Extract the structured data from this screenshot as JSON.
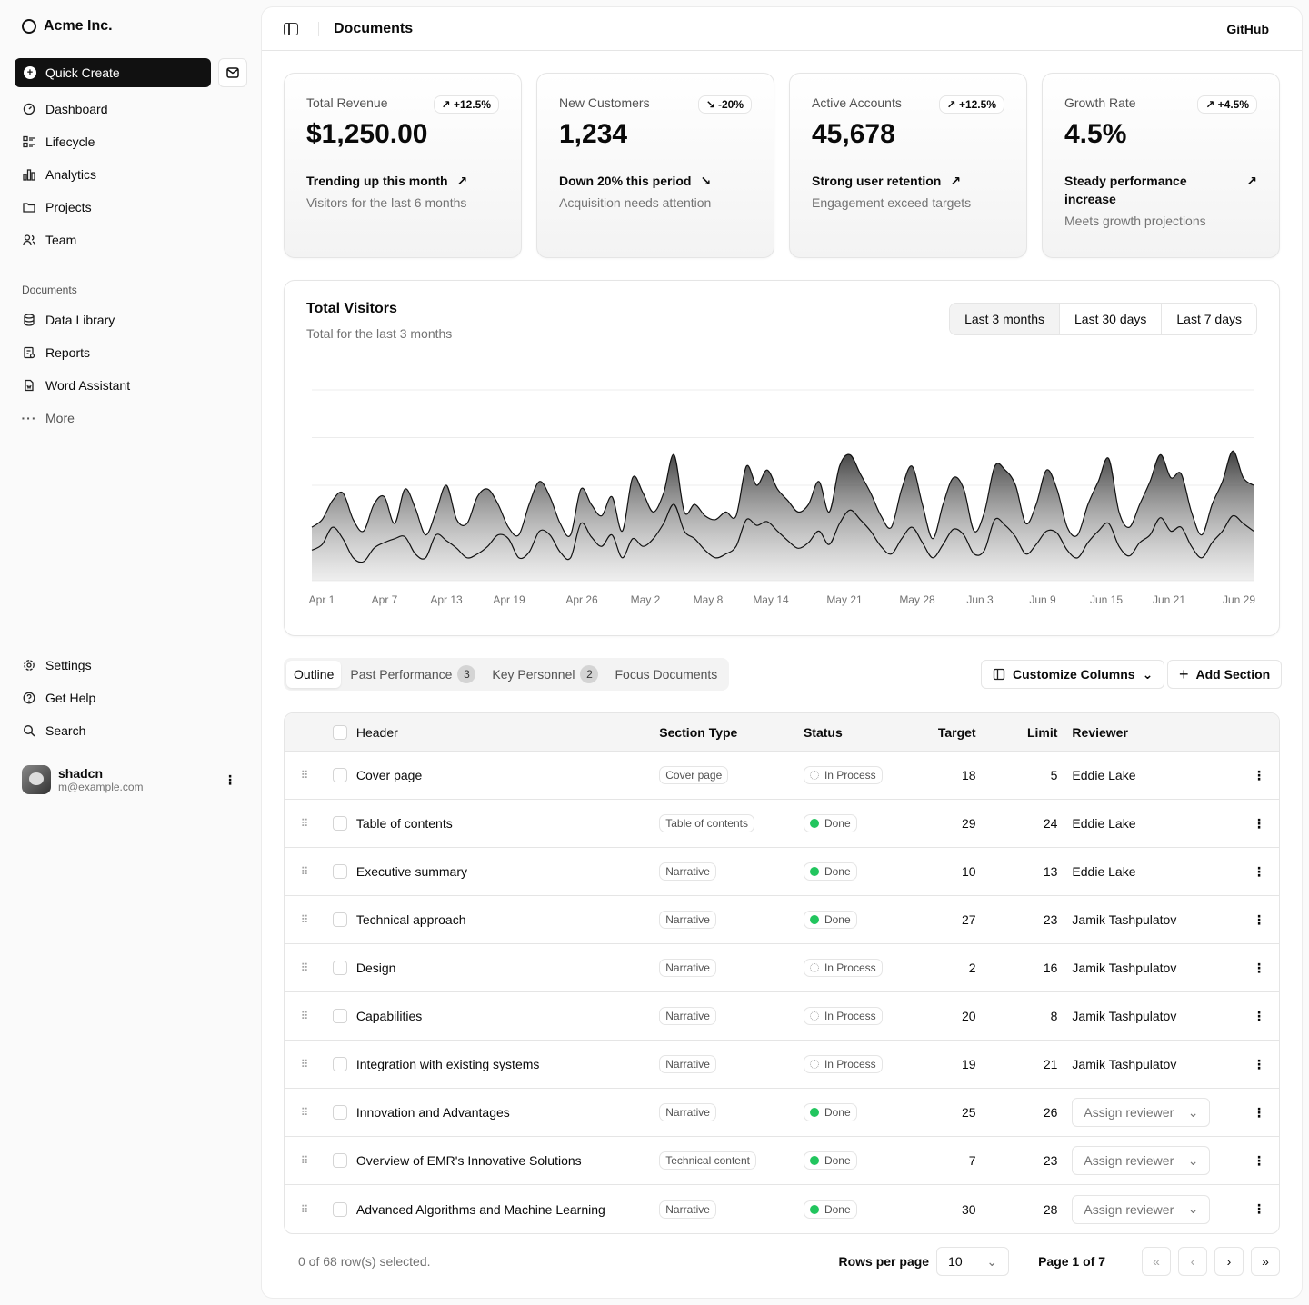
{
  "app": {
    "brand": "Acme Inc.",
    "page_title": "Documents",
    "github_label": "GitHub"
  },
  "sidebar": {
    "quick_create": "Quick Create",
    "main_items": [
      {
        "label": "Dashboard",
        "icon": "dashboard-icon"
      },
      {
        "label": "Lifecycle",
        "icon": "list-details-icon"
      },
      {
        "label": "Analytics",
        "icon": "chart-bar-icon"
      },
      {
        "label": "Projects",
        "icon": "folder-icon"
      },
      {
        "label": "Team",
        "icon": "users-icon"
      }
    ],
    "documents_label": "Documents",
    "doc_items": [
      {
        "label": "Data Library",
        "icon": "database-icon"
      },
      {
        "label": "Reports",
        "icon": "report-icon"
      },
      {
        "label": "Word Assistant",
        "icon": "file-word-icon"
      },
      {
        "label": "More",
        "icon": "dots-icon"
      }
    ],
    "bottom_items": [
      {
        "label": "Settings",
        "icon": "settings-icon"
      },
      {
        "label": "Get Help",
        "icon": "help-icon"
      },
      {
        "label": "Search",
        "icon": "search-icon"
      }
    ],
    "user": {
      "name": "shadcn",
      "email": "m@example.com"
    }
  },
  "cards": [
    {
      "label": "Total Revenue",
      "badge": "+12.5%",
      "direction": "up",
      "value": "$1,250.00",
      "trend": "Trending up this month",
      "sub": "Visitors for the last 6 months"
    },
    {
      "label": "New Customers",
      "badge": "-20%",
      "direction": "down",
      "value": "1,234",
      "trend": "Down 20% this period",
      "sub": "Acquisition needs attention"
    },
    {
      "label": "Active Accounts",
      "badge": "+12.5%",
      "direction": "up",
      "value": "45,678",
      "trend": "Strong user retention",
      "sub": "Engagement exceed targets"
    },
    {
      "label": "Growth Rate",
      "badge": "+4.5%",
      "direction": "up",
      "value": "4.5%",
      "trend": "Steady performance increase",
      "sub": "Meets growth projections"
    }
  ],
  "chart_card": {
    "title": "Total Visitors",
    "subtitle": "Total for the last 3 months",
    "ranges": [
      "Last 3 months",
      "Last 30 days",
      "Last 7 days"
    ],
    "selected_range": "Last 3 months"
  },
  "chart_data": {
    "type": "area",
    "title": "Total Visitors",
    "x_tick_labels": [
      "Apr 1",
      "Apr 7",
      "Apr 13",
      "Apr 19",
      "Apr 26",
      "May 2",
      "May 8",
      "May 14",
      "May 21",
      "May 28",
      "Jun 3",
      "Jun 9",
      "Jun 15",
      "Jun 21",
      "Jun 29"
    ],
    "y_range": [
      0,
      500
    ],
    "grid": "horizontal",
    "stacked": true,
    "series": [
      {
        "values": [
          80,
          95,
          140,
          110,
          60,
          50,
          85,
          100,
          110,
          115,
          70,
          60,
          120,
          105,
          85,
          60,
          70,
          90,
          120,
          110,
          60,
          75,
          130,
          120,
          75,
          60,
          150,
          115,
          90,
          120,
          60,
          110,
          90,
          110,
          150,
          200,
          130,
          110,
          80,
          60,
          70,
          90,
          160,
          145,
          155,
          130,
          105,
          85,
          100,
          130,
          95,
          150,
          185,
          160,
          130,
          90,
          70,
          110,
          140,
          100,
          60,
          95,
          135,
          120,
          70,
          80,
          160,
          145,
          115,
          70,
          95,
          130,
          125,
          80,
          60,
          100,
          130,
          150,
          90,
          65,
          100,
          120,
          165,
          130,
          140,
          90,
          60,
          100,
          130,
          170,
          150,
          130
        ]
      },
      {
        "values": [
          140,
          160,
          210,
          230,
          160,
          130,
          200,
          220,
          150,
          240,
          190,
          120,
          180,
          250,
          160,
          150,
          220,
          240,
          200,
          140,
          120,
          200,
          260,
          220,
          150,
          120,
          240,
          200,
          170,
          220,
          130,
          270,
          230,
          180,
          230,
          330,
          180,
          200,
          170,
          160,
          180,
          170,
          300,
          250,
          290,
          240,
          210,
          180,
          200,
          260,
          180,
          300,
          330,
          280,
          230,
          170,
          140,
          240,
          300,
          200,
          110,
          200,
          270,
          240,
          130,
          180,
          300,
          290,
          250,
          150,
          200,
          290,
          240,
          140,
          120,
          200,
          260,
          320,
          180,
          140,
          200,
          260,
          330,
          270,
          280,
          180,
          120,
          200,
          260,
          340,
          270,
          250
        ]
      }
    ]
  },
  "tabs": [
    {
      "label": "Outline",
      "count": ""
    },
    {
      "label": "Past Performance",
      "count": "3"
    },
    {
      "label": "Key Personnel",
      "count": "2"
    },
    {
      "label": "Focus Documents",
      "count": ""
    }
  ],
  "actions": {
    "customize": "Customize Columns",
    "add_section": "Add Section"
  },
  "table": {
    "columns": [
      "Header",
      "Section Type",
      "Status",
      "Target",
      "Limit",
      "Reviewer"
    ],
    "rows": [
      {
        "header": "Cover page",
        "type": "Cover page",
        "status": "In Process",
        "target": "18",
        "limit": "5",
        "reviewer": "Eddie Lake"
      },
      {
        "header": "Table of contents",
        "type": "Table of contents",
        "status": "Done",
        "target": "29",
        "limit": "24",
        "reviewer": "Eddie Lake"
      },
      {
        "header": "Executive summary",
        "type": "Narrative",
        "status": "Done",
        "target": "10",
        "limit": "13",
        "reviewer": "Eddie Lake"
      },
      {
        "header": "Technical approach",
        "type": "Narrative",
        "status": "Done",
        "target": "27",
        "limit": "23",
        "reviewer": "Jamik Tashpulatov"
      },
      {
        "header": "Design",
        "type": "Narrative",
        "status": "In Process",
        "target": "2",
        "limit": "16",
        "reviewer": "Jamik Tashpulatov"
      },
      {
        "header": "Capabilities",
        "type": "Narrative",
        "status": "In Process",
        "target": "20",
        "limit": "8",
        "reviewer": "Jamik Tashpulatov"
      },
      {
        "header": "Integration with existing systems",
        "type": "Narrative",
        "status": "In Process",
        "target": "19",
        "limit": "21",
        "reviewer": "Jamik Tashpulatov"
      },
      {
        "header": "Innovation and Advantages",
        "type": "Narrative",
        "status": "Done",
        "target": "25",
        "limit": "26",
        "reviewer": "Assign reviewer"
      },
      {
        "header": "Overview of EMR's Innovative Solutions",
        "type": "Technical content",
        "status": "Done",
        "target": "7",
        "limit": "23",
        "reviewer": "Assign reviewer"
      },
      {
        "header": "Advanced Algorithms and Machine Learning",
        "type": "Narrative",
        "status": "Done",
        "target": "30",
        "limit": "28",
        "reviewer": "Assign reviewer"
      }
    ]
  },
  "footer": {
    "selected": "0 of 68 row(s) selected.",
    "rows_per_page_label": "Rows per page",
    "rows_per_page": "10",
    "page": "Page 1 of 7"
  }
}
